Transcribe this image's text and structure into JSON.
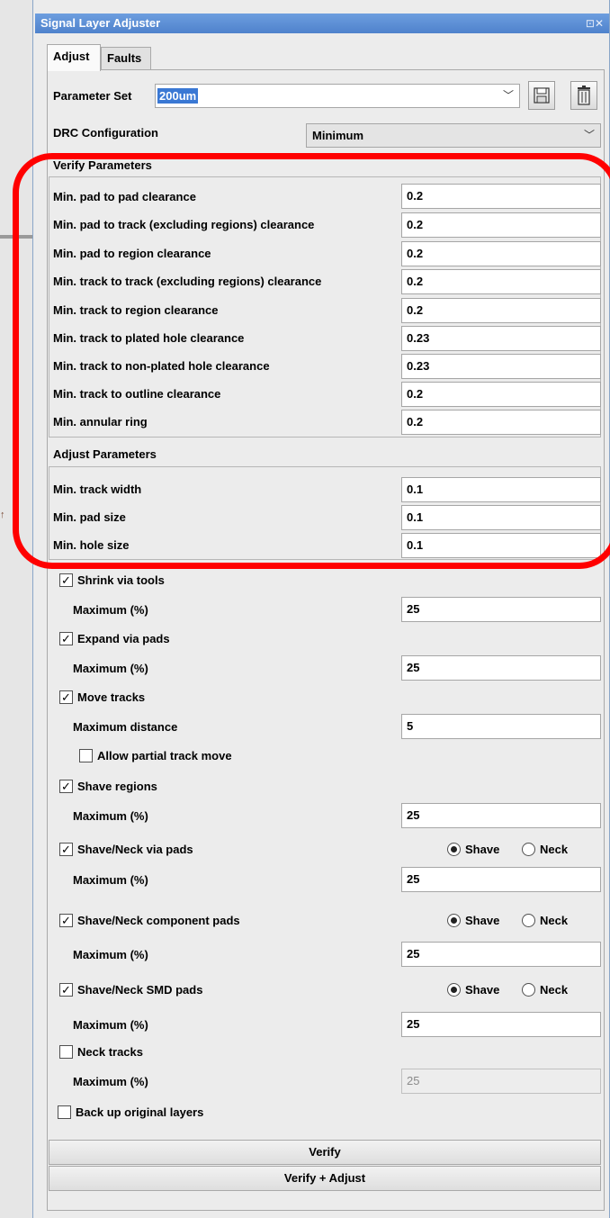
{
  "window": {
    "title": "Signal Layer Adjuster",
    "controls": "⊡✕"
  },
  "tabs": [
    {
      "label": "Adjust"
    },
    {
      "label": "Faults"
    }
  ],
  "parameter_set": {
    "label": "Parameter Set",
    "value": "200um"
  },
  "drc": {
    "label": "DRC Configuration",
    "value": "Minimum"
  },
  "verify": {
    "title": "Verify Parameters",
    "rows": [
      {
        "label": "Min. pad to pad clearance",
        "value": "0.2"
      },
      {
        "label": "Min. pad to track (excluding regions) clearance",
        "value": "0.2"
      },
      {
        "label": "Min. pad to region clearance",
        "value": "0.2"
      },
      {
        "label": "Min. track to track (excluding regions) clearance",
        "value": "0.2"
      },
      {
        "label": "Min. track to region clearance",
        "value": "0.2"
      },
      {
        "label": "Min. track to plated hole clearance",
        "value": "0.23"
      },
      {
        "label": "Min. track to non-plated hole clearance",
        "value": "0.23"
      },
      {
        "label": "Min. track to outline clearance",
        "value": "0.2"
      },
      {
        "label": "Min. annular ring",
        "value": "0.2"
      }
    ]
  },
  "adjust": {
    "title": "Adjust Parameters",
    "rows": [
      {
        "label": "Min. track width",
        "value": "0.1"
      },
      {
        "label": "Min. pad size",
        "value": "0.1"
      },
      {
        "label": "Min. hole size",
        "value": "0.1"
      }
    ]
  },
  "options": {
    "shrink_via_tools": {
      "label": "Shrink via tools",
      "checked": true,
      "max_label": "Maximum (%)",
      "max_value": "25"
    },
    "expand_via_pads": {
      "label": "Expand via pads",
      "checked": true,
      "max_label": "Maximum (%)",
      "max_value": "25"
    },
    "move_tracks": {
      "label": "Move tracks",
      "checked": true,
      "max_label": "Maximum distance",
      "max_value": "5"
    },
    "allow_partial": {
      "label": "Allow partial track move",
      "checked": false
    },
    "shave_regions": {
      "label": "Shave regions",
      "checked": true,
      "max_label": "Maximum (%)",
      "max_value": "25"
    },
    "shave_via_pads": {
      "label": "Shave/Neck via pads",
      "checked": true,
      "max_label": "Maximum (%)",
      "max_value": "25",
      "mode": "Shave"
    },
    "shave_component_pads": {
      "label": "Shave/Neck component pads",
      "checked": true,
      "max_label": "Maximum (%)",
      "max_value": "25",
      "mode": "Shave"
    },
    "shave_smd_pads": {
      "label": "Shave/Neck SMD pads",
      "checked": true,
      "max_label": "Maximum (%)",
      "max_value": "25",
      "mode": "Shave"
    },
    "neck_tracks": {
      "label": "Neck tracks",
      "checked": false,
      "max_label": "Maximum (%)",
      "max_value": "25"
    }
  },
  "radio_labels": {
    "shave": "Shave",
    "neck": "Neck"
  },
  "backup": {
    "label": "Back up original layers",
    "checked": false
  },
  "buttons": {
    "verify": "Verify",
    "verify_adjust": "Verify + Adjust"
  },
  "icons": {
    "save": "save-icon",
    "delete": "trash-icon",
    "check": "checkmark-icon"
  },
  "colors": {
    "title_bar": "#5b8ed7",
    "selection": "#3a78d4",
    "highlight_ring": "#ff0000"
  }
}
